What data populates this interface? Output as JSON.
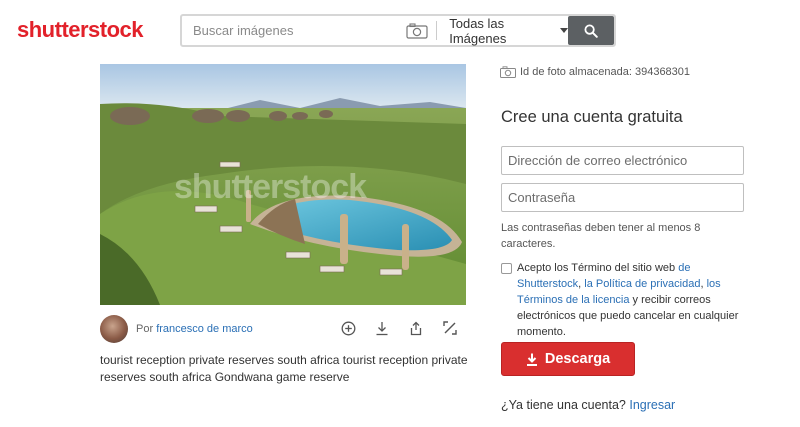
{
  "header": {
    "logo_text": "shutterstock",
    "brand_color": "#e2212a",
    "search": {
      "placeholder": "Buscar imágenes",
      "value": "",
      "camera_icon": "camera-icon",
      "type_selected": "Todas las Imágenes",
      "search_icon": "search-icon"
    }
  },
  "photo": {
    "watermark": "shutterstock",
    "author_prefix": "Por",
    "author_name": "francesco de marco",
    "actions": [
      "add-circle-icon",
      "download-icon",
      "share-icon",
      "resize-icon"
    ],
    "description": "tourist reception private reserves south africa tourist reception private reserves south africa Gondwana game reserve"
  },
  "signup": {
    "photo_id": "Id de foto almacenada: 394368301",
    "title": "Cree una cuenta gratuita",
    "email_placeholder": "Dirección de correo electrónico",
    "password_placeholder": "Contraseña",
    "password_hint": "Las contraseñas deben tener al menos 8 caracteres.",
    "terms": {
      "pre": "Acepto los Término del sitio web ",
      "link1": "de Shutterstock",
      "sep1": ", ",
      "link2": "la Política de privacidad",
      "sep2": ", ",
      "link3": "los Términos de la licencia",
      "post": " y recibir correos electrónicos que puedo cancelar en cualquier momento."
    },
    "download_label": "Descarga",
    "login_prompt": "¿Ya tiene una cuenta?",
    "login_link": "Ingresar",
    "download_color": "#d92f2f",
    "link_color": "#2a6fb5"
  }
}
